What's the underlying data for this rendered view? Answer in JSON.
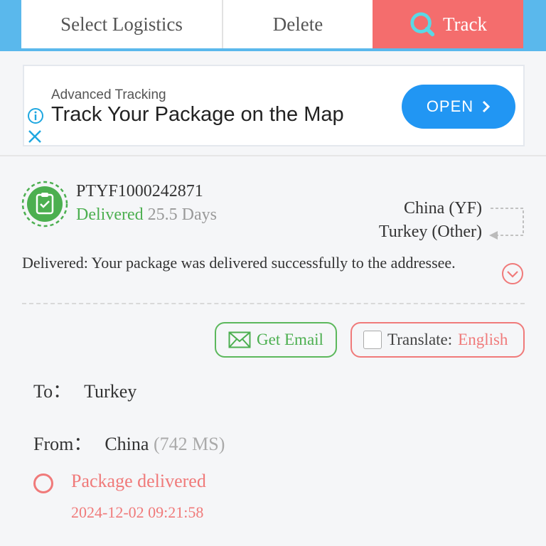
{
  "tabs": {
    "select_logistics": "Select Logistics",
    "delete": "Delete",
    "track": "Track"
  },
  "ad": {
    "label": "Advanced Tracking",
    "title": "Track Your Package on the Map",
    "button": "OPEN"
  },
  "package": {
    "tracking_number": "PTYF1000242871",
    "status": "Delivered",
    "duration": "25.5 Days",
    "origin": "China (YF)",
    "destination": "Turkey (Other)",
    "latest_event": "Delivered: Your package was delivered successfully to the addressee."
  },
  "actions": {
    "get_email": "Get Email",
    "translate_label": "Translate:",
    "translate_language": "English"
  },
  "details": {
    "to_label": "To：",
    "to_value": "Turkey",
    "from_label": "From：",
    "from_value": "China",
    "from_latency": "(742 MS)"
  },
  "events": [
    {
      "title": "Package delivered",
      "time": "2024-12-02 09:21:58"
    }
  ],
  "colors": {
    "topbar": "#5ab8ec",
    "track_tab": "#f46d6d",
    "delivered_green": "#4caf50",
    "accent_red": "#f07a7a",
    "ad_button": "#2196f3"
  }
}
